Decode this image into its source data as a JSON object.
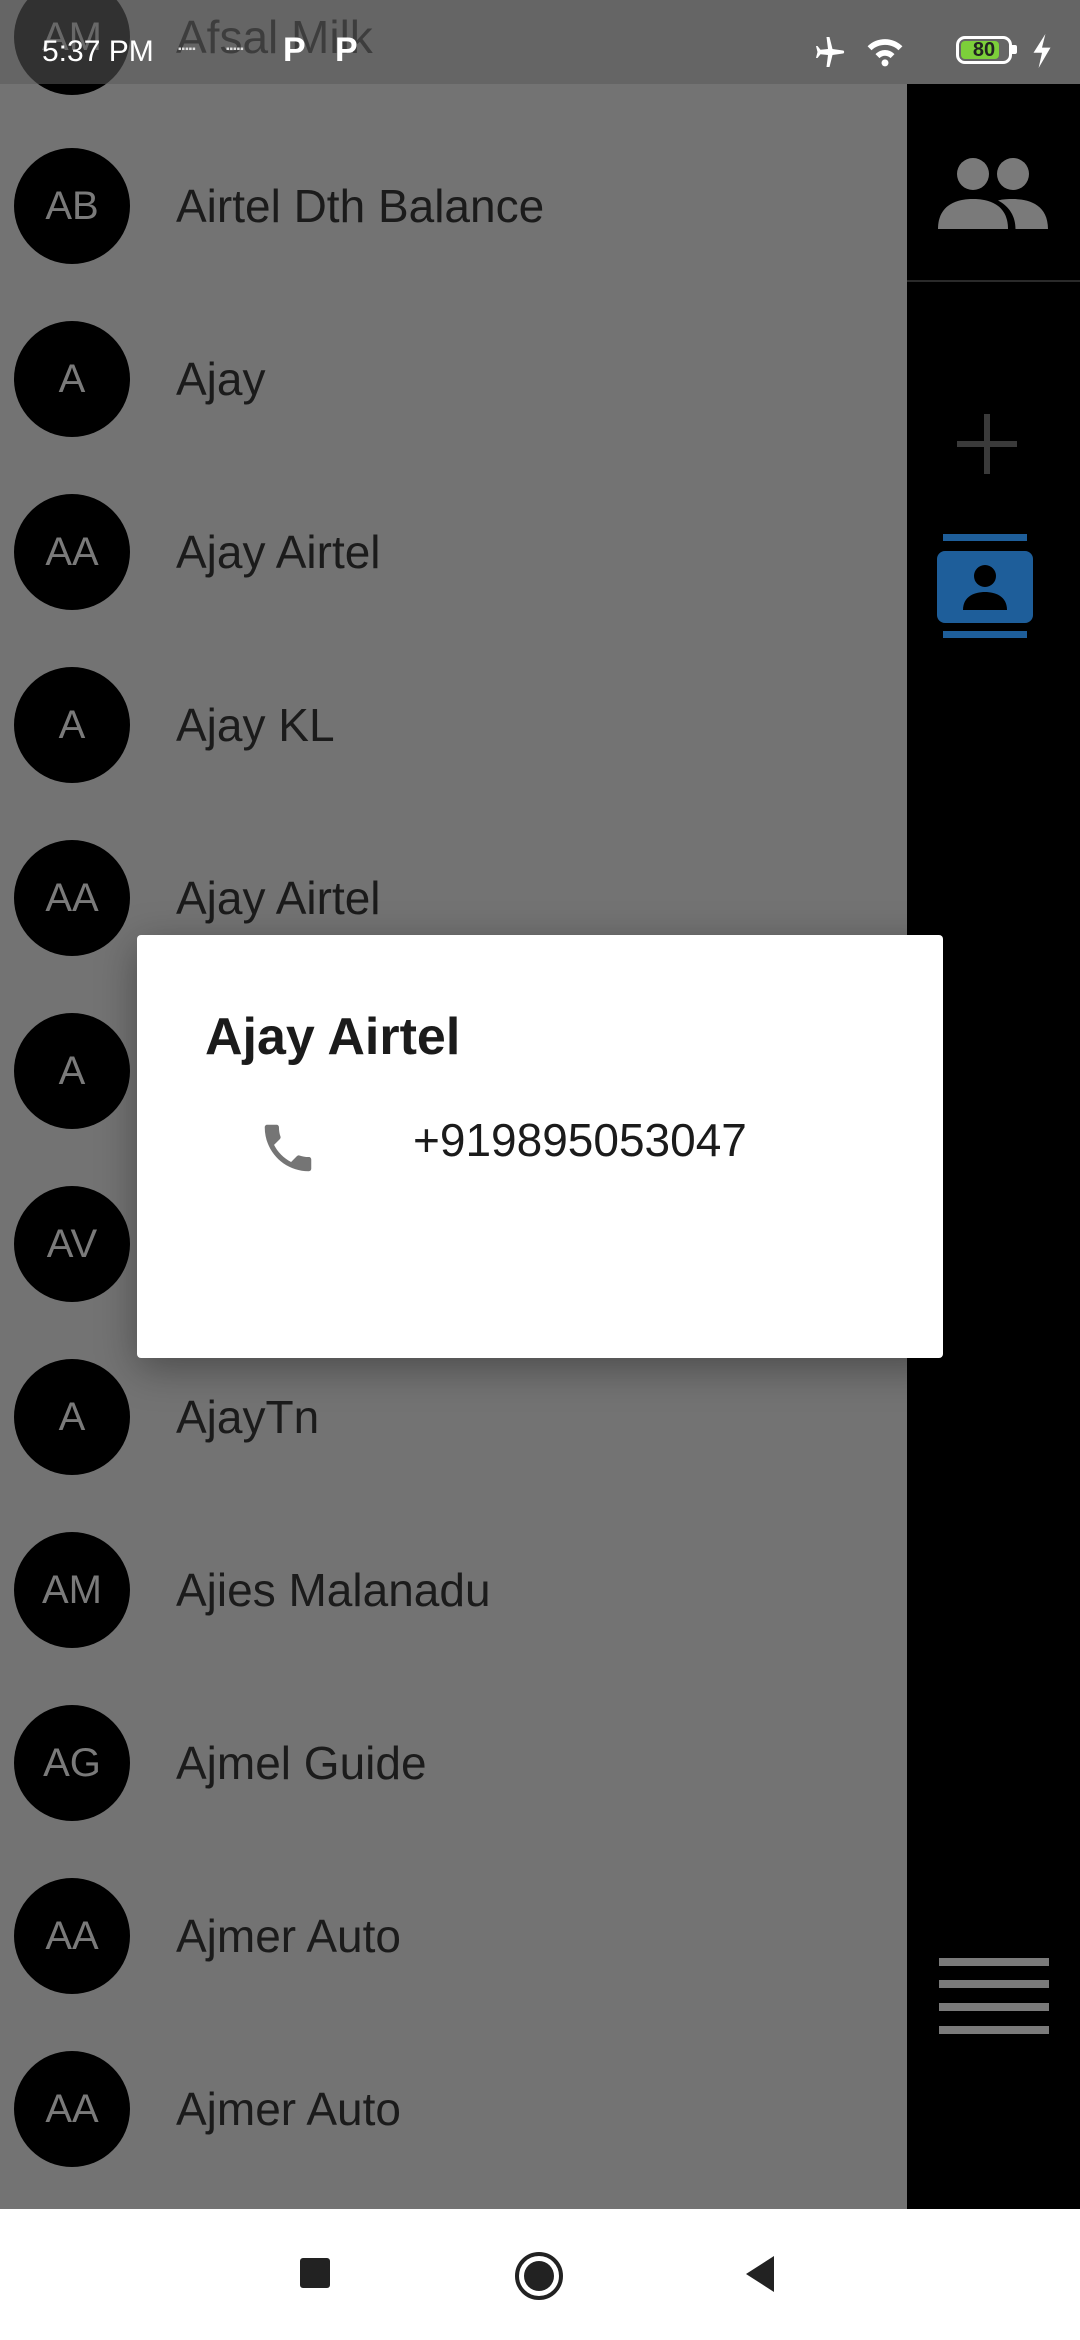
{
  "status_bar": {
    "time": "5:37 PM",
    "battery": "80"
  },
  "contacts": [
    {
      "initials": "AM",
      "name": "Afsal Milk"
    },
    {
      "initials": "AB",
      "name": "Airtel Dth Balance"
    },
    {
      "initials": "A",
      "name": "Ajay"
    },
    {
      "initials": "AA",
      "name": "Ajay Airtel"
    },
    {
      "initials": "A",
      "name": "Ajay KL"
    },
    {
      "initials": "AA",
      "name": "Ajay Airtel"
    },
    {
      "initials": "A",
      "name": ""
    },
    {
      "initials": "AV",
      "name": ""
    },
    {
      "initials": "A",
      "name": "AjayTn"
    },
    {
      "initials": "AM",
      "name": "Ajies Malanadu"
    },
    {
      "initials": "AG",
      "name": "Ajmel Guide"
    },
    {
      "initials": "AA",
      "name": "Ajmer Auto"
    },
    {
      "initials": "AA",
      "name": "Ajmer Auto"
    }
  ],
  "rail": {
    "icons": [
      "groups-icon",
      "add-icon",
      "contact-card-icon",
      "menu-icon"
    ],
    "accent_color": "#1e5e9a"
  },
  "dialog": {
    "title": "Ajay Airtel",
    "phone_number": "+919895053047",
    "phone_icon": "phone-icon"
  },
  "nav_bar": {
    "icons": [
      "recents-icon",
      "home-icon",
      "back-icon"
    ]
  }
}
